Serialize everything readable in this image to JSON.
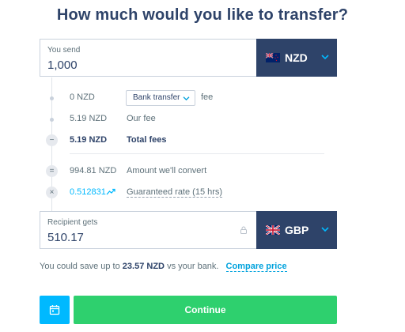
{
  "title": "How much would you like to transfer?",
  "send": {
    "label": "You send",
    "value": "1,000",
    "currency": "NZD",
    "flag": "new-zealand-flag"
  },
  "fees": {
    "transfer_fee_amount": "0 NZD",
    "transfer_method": "Bank transfer",
    "transfer_fee_suffix": "fee",
    "our_fee_amount": "5.19 NZD",
    "our_fee_label": "Our fee",
    "total_fees_symbol": "−",
    "total_fees_amount": "5.19 NZD",
    "total_fees_label": "Total fees",
    "convert_symbol": "=",
    "convert_amount": "994.81 NZD",
    "convert_label": "Amount we'll convert",
    "rate_symbol": "×",
    "rate_value": "0.512831",
    "rate_trend_icon": "trend-up-icon",
    "rate_label": "Guaranteed rate (15 hrs)"
  },
  "recipient": {
    "label": "Recipient gets",
    "value": "510.17",
    "currency": "GBP",
    "flag": "united-kingdom-flag"
  },
  "savings": {
    "prefix": "You could save up to",
    "amount": "23.57 NZD",
    "suffix": "vs your bank.",
    "link": "Compare price"
  },
  "actions": {
    "calendar_icon": "calendar-icon",
    "continue_label": "Continue"
  },
  "colors": {
    "navy": "#2e4369",
    "accent_blue": "#00b9ff",
    "green": "#2ed06e"
  }
}
